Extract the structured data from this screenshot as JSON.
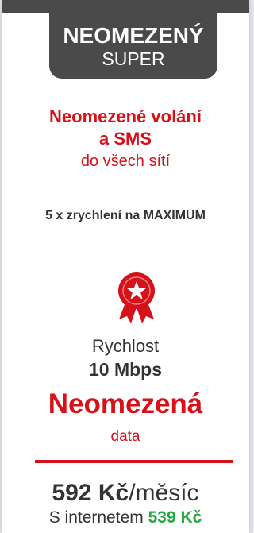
{
  "tariff": {
    "name": "NEOMEZENÝ",
    "tier": "SUPER"
  },
  "calls": {
    "line1": "Neomezené volání",
    "line2": "a SMS",
    "line3": "do všech sítí"
  },
  "speedup": "5 x zrychlení na MAXIMUM",
  "badge_icon": "award-ribbon-star-icon",
  "speed": {
    "label": "Rychlost",
    "value": "10 Mbps"
  },
  "data": {
    "big": "Neomezená",
    "small": "data"
  },
  "price": {
    "amount": "592 Kč",
    "period": "/měsíc"
  },
  "internet_price": {
    "prefix": "S internetem",
    "amount": "539 Kč"
  },
  "colors": {
    "accent_red": "#d6111a",
    "header_gray": "#4a4a4a",
    "price_green": "#28a745"
  }
}
